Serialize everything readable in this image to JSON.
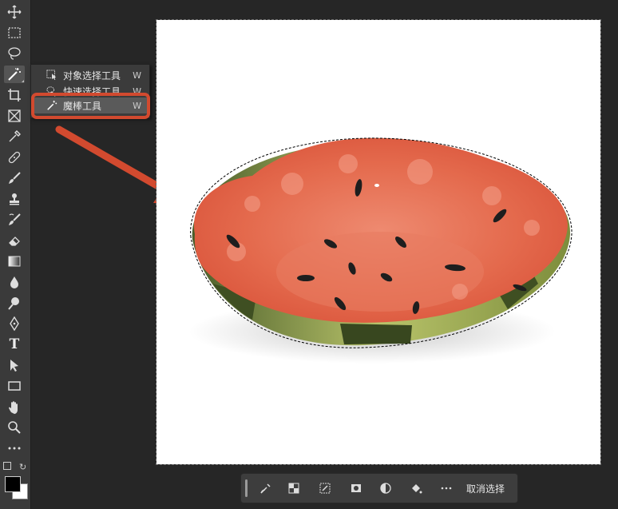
{
  "flyout": {
    "items": [
      {
        "label": "对象选择工具",
        "shortcut": "W"
      },
      {
        "label": "快速选择工具",
        "shortcut": "W"
      },
      {
        "label": "魔棒工具",
        "shortcut": "W"
      }
    ]
  },
  "toolbar": {
    "tools": [
      "move-icon",
      "rectangular-marquee-icon",
      "lasso-icon",
      "magic-wand-icon",
      "crop-icon",
      "frame-icon",
      "eyedropper-icon",
      "healing-brush-icon",
      "brush-icon",
      "clone-stamp-icon",
      "history-brush-icon",
      "eraser-icon",
      "gradient-icon",
      "blur-icon",
      "dodge-icon",
      "pen-icon",
      "type-icon",
      "path-selection-icon",
      "rectangle-icon",
      "hand-icon",
      "zoom-icon",
      "more-icon"
    ],
    "type_glyph": "T"
  },
  "colors": {
    "accent": "#d24a2f",
    "foreground": "#000000",
    "background": "#ffffff"
  },
  "taskbar": {
    "deselect_label": "取消选择",
    "buttons": [
      "refine-brush-icon",
      "invert-selection-icon",
      "transform-selection-icon",
      "mask-icon",
      "adjustment-icon",
      "fill-icon",
      "more-icon"
    ]
  }
}
